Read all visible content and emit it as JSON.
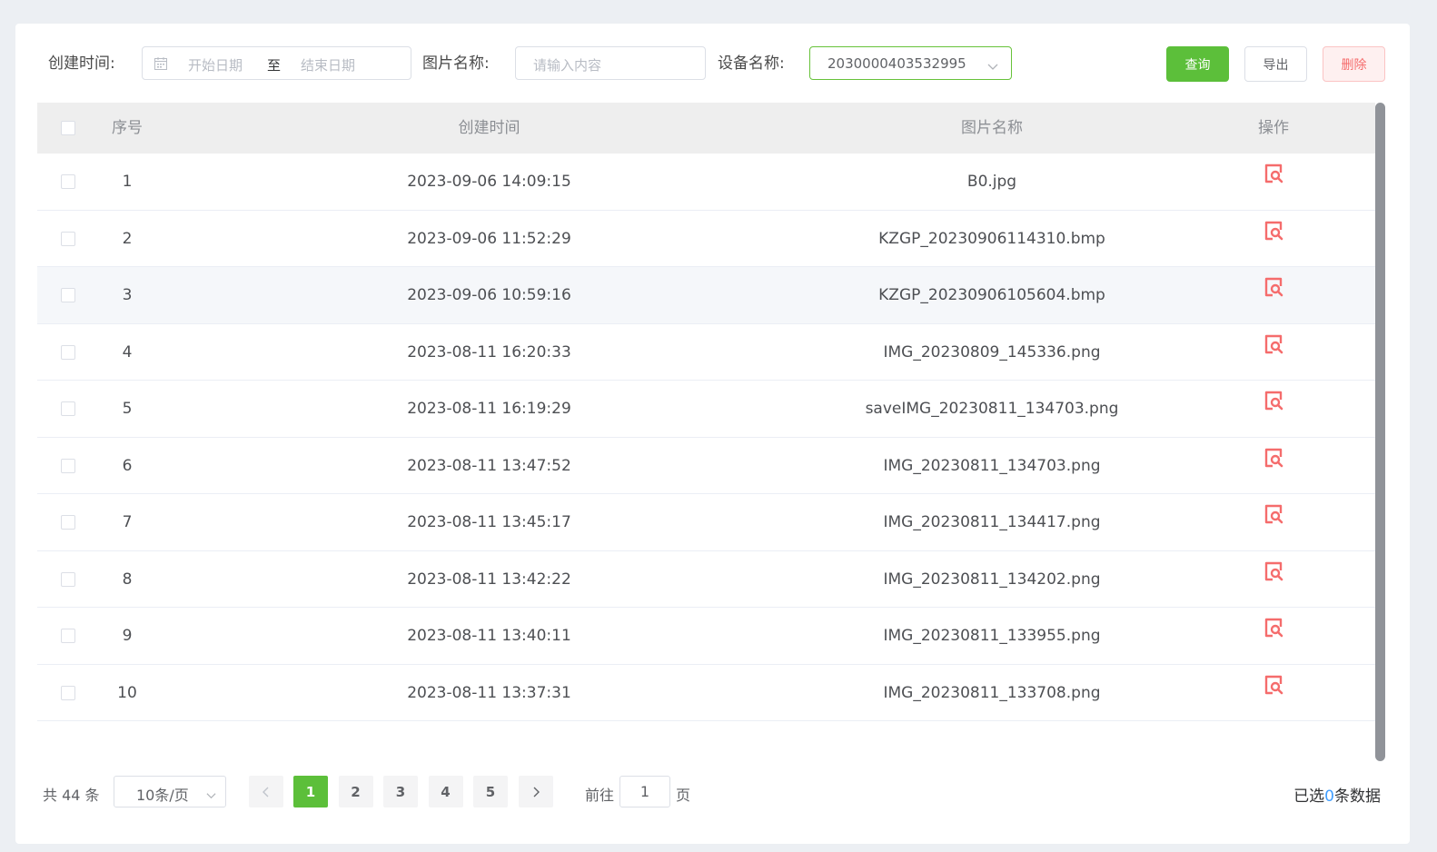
{
  "filters": {
    "create_time_label": "创建时间:",
    "start_placeholder": "开始日期",
    "range_separator": "至",
    "end_placeholder": "结束日期",
    "image_name_label": "图片名称:",
    "image_name_placeholder": "请输入内容",
    "device_name_label": "设备名称:",
    "device_value": "2030000403532995"
  },
  "buttons": {
    "query": "查询",
    "export": "导出",
    "delete": "删除"
  },
  "table": {
    "headers": {
      "index": "序号",
      "create_time": "创建时间",
      "image_name": "图片名称",
      "operation": "操作"
    },
    "rows": [
      {
        "index": "1",
        "time": "2023-09-06 14:09:15",
        "name": "B0.jpg"
      },
      {
        "index": "2",
        "time": "2023-09-06 11:52:29",
        "name": "KZGP_20230906114310.bmp"
      },
      {
        "index": "3",
        "time": "2023-09-06 10:59:16",
        "name": "KZGP_20230906105604.bmp"
      },
      {
        "index": "4",
        "time": "2023-08-11 16:20:33",
        "name": "IMG_20230809_145336.png"
      },
      {
        "index": "5",
        "time": "2023-08-11 16:19:29",
        "name": "saveIMG_20230811_134703.png"
      },
      {
        "index": "6",
        "time": "2023-08-11 13:47:52",
        "name": "IMG_20230811_134703.png"
      },
      {
        "index": "7",
        "time": "2023-08-11 13:45:17",
        "name": "IMG_20230811_134417.png"
      },
      {
        "index": "8",
        "time": "2023-08-11 13:42:22",
        "name": "IMG_20230811_134202.png"
      },
      {
        "index": "9",
        "time": "2023-08-11 13:40:11",
        "name": "IMG_20230811_133955.png"
      },
      {
        "index": "10",
        "time": "2023-08-11 13:37:31",
        "name": "IMG_20230811_133708.png"
      }
    ],
    "op_icon": "view-image-icon",
    "op_icon_color": "#f56c6c"
  },
  "pagination": {
    "total_text": "共 44 条",
    "page_size": "10条/页",
    "pages": [
      "1",
      "2",
      "3",
      "4",
      "5"
    ],
    "current_page": "1",
    "goto_label": "前往",
    "goto_value": "1",
    "page_suffix": "页"
  },
  "selection": {
    "prefix": "已选",
    "count": "0",
    "suffix": "条数据"
  },
  "colors": {
    "primary": "#5cbf3a",
    "danger": "#f56c6c",
    "link": "#409eff"
  }
}
